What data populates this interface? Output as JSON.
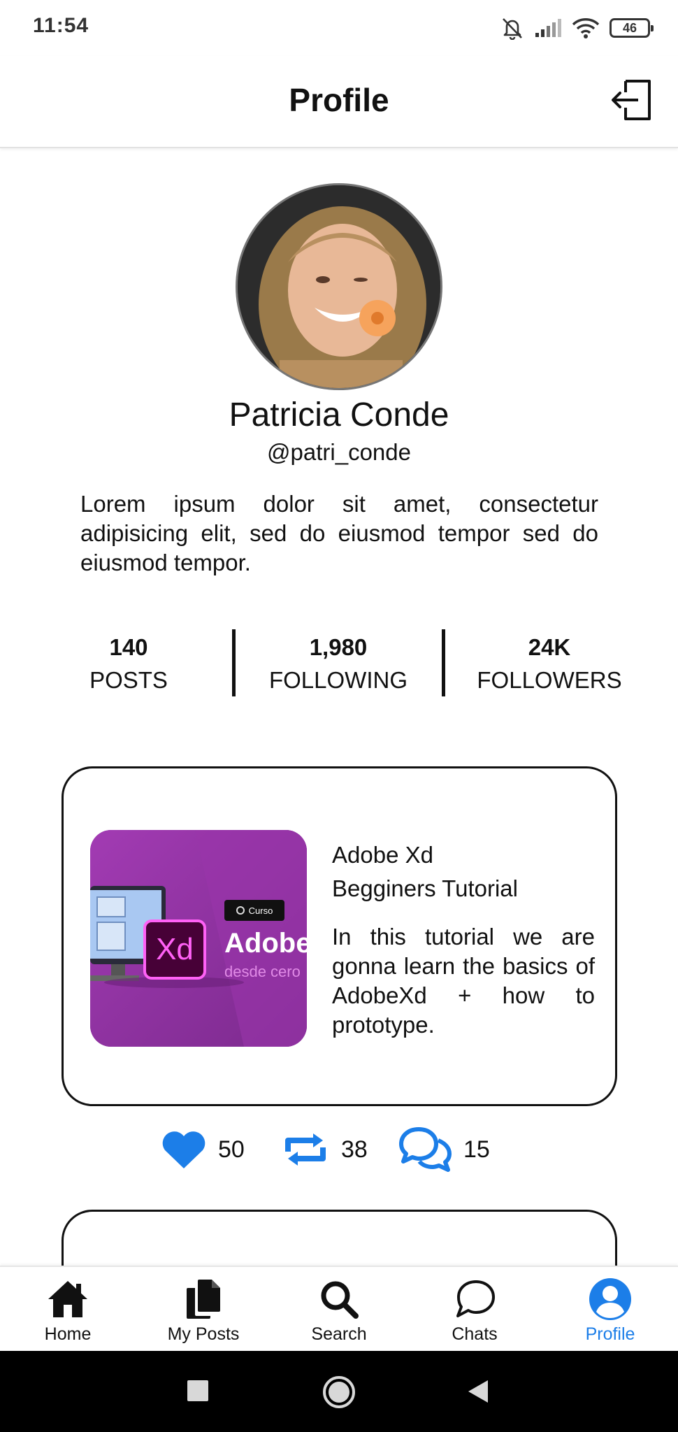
{
  "status_bar": {
    "time": "11:54",
    "battery": "46",
    "icons": [
      "bell-muted-icon",
      "signal-icon",
      "wifi-icon",
      "battery-icon"
    ]
  },
  "header": {
    "title": "Profile",
    "logout_icon": "logout-icon"
  },
  "profile": {
    "name": "Patricia Conde",
    "handle": "@patri_conde",
    "bio": "Lorem ipsum dolor sit amet, consectetur adipisicing elit, sed do eiusmod tempor sed do eiusmod tempor."
  },
  "stats": [
    {
      "value": "140",
      "label": "POSTS"
    },
    {
      "value": "1,980",
      "label": "FOLLOWING"
    },
    {
      "value": "24K",
      "label": "FOLLOWERS"
    }
  ],
  "post": {
    "title_line1": "Adobe Xd",
    "title_line2": "Begginers Tutorial",
    "description": "In this tutorial we are gonna learn the basics of AdobeXd + how to prototype.",
    "thumb": {
      "badge": "Curso",
      "logo": "Xd",
      "brand": "Adobe",
      "tagline": "desde cero"
    },
    "likes": "50",
    "reposts": "38",
    "comments": "15"
  },
  "bottom_nav": [
    {
      "label": "Home",
      "icon": "home-icon"
    },
    {
      "label": "My Posts",
      "icon": "documents-icon"
    },
    {
      "label": "Search",
      "icon": "search-icon"
    },
    {
      "label": "Chats",
      "icon": "chat-icon"
    },
    {
      "label": "Profile",
      "icon": "user-circle-icon",
      "active": true
    }
  ],
  "colors": {
    "accent": "#1c7ee8",
    "text": "#111111",
    "thumb_bg": "#8a2f9c"
  }
}
